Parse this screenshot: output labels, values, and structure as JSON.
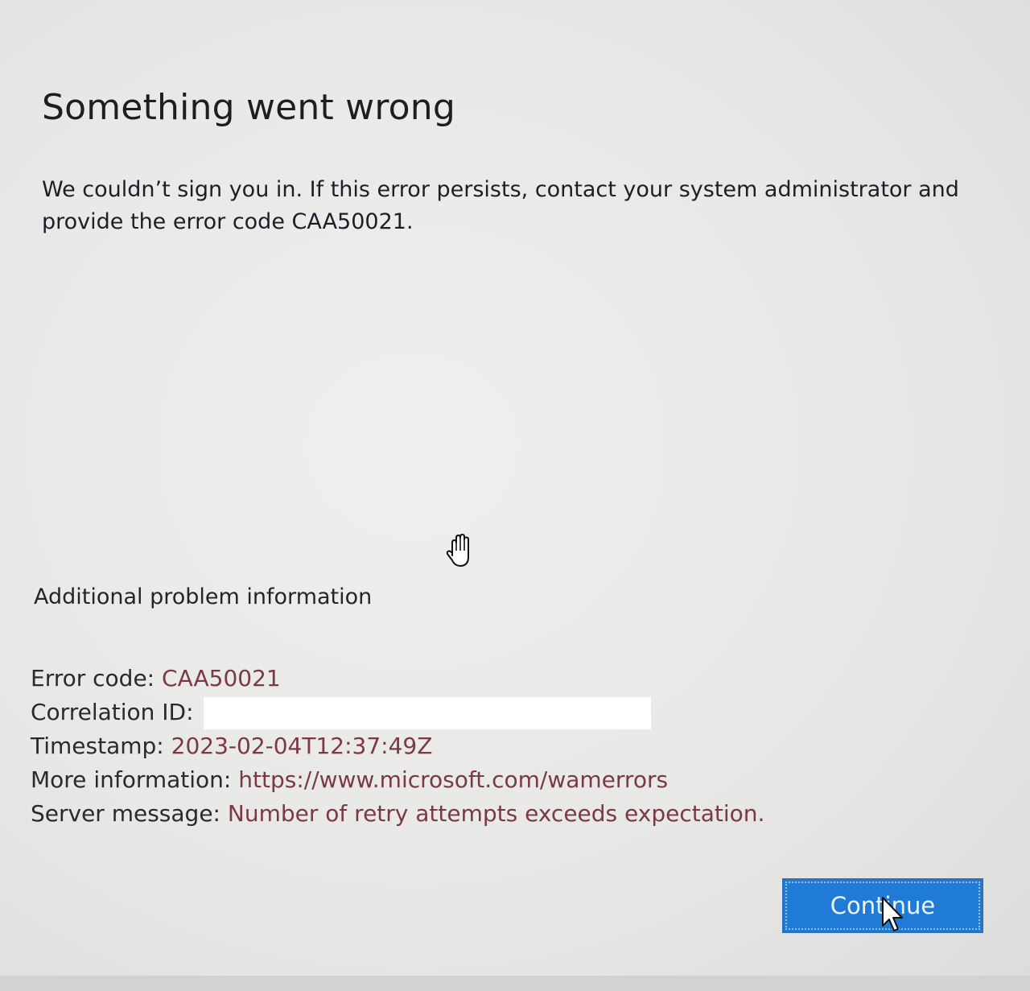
{
  "dialog": {
    "title": "Something went wrong",
    "message": "We couldn’t sign you in. If this error persists, contact your system administrator and provide the error code CAA50021."
  },
  "additional_info": {
    "heading": "Additional problem information",
    "error_code_label": "Error code:",
    "error_code_value": "CAA50021",
    "correlation_id_label": "Correlation ID:",
    "timestamp_label": "Timestamp:",
    "timestamp_value": "2023-02-04T12:37:49Z",
    "more_info_label": "More information:",
    "more_info_value": "https://www.microsoft.com/wamerrors",
    "server_message_label": "Server message:",
    "server_message_value": "Number of retry attempts exceeds expectation."
  },
  "actions": {
    "continue_label": "Continue"
  },
  "colors": {
    "button_blue": "#1f7bd6",
    "value_text": "#7a3a44",
    "background": "#e8e8e6"
  },
  "icons": {
    "pointer": "hand-cursor-icon",
    "arrow": "arrow-cursor-icon"
  }
}
